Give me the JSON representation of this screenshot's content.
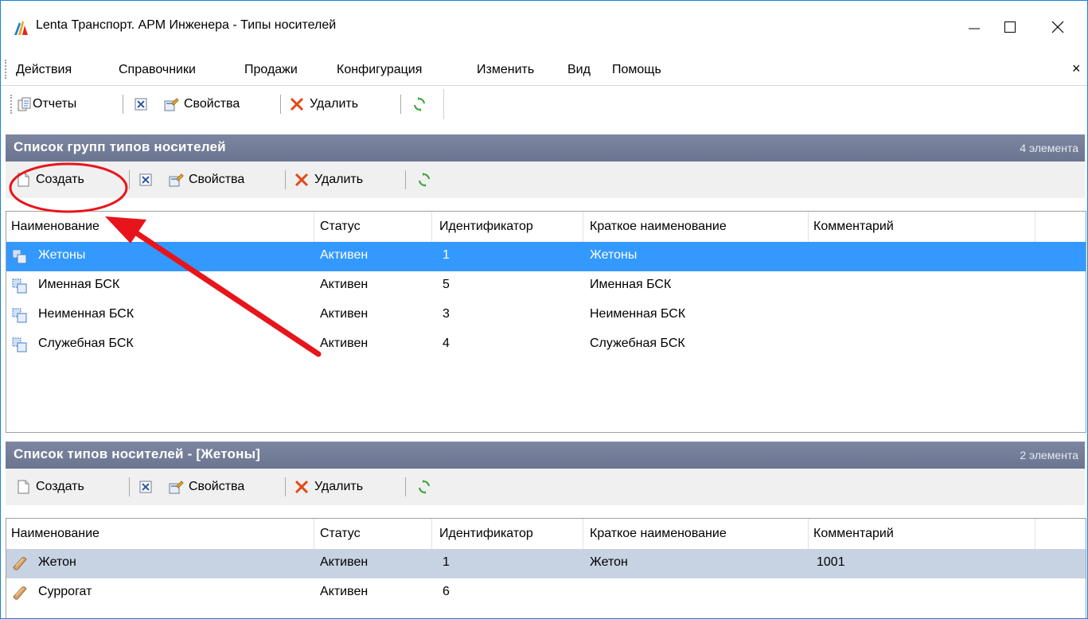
{
  "window": {
    "title": "Lenta Транспорт. АРМ Инженера - Типы носителей"
  },
  "menu": {
    "items": [
      "Действия",
      "Справочники",
      "Продажи",
      "Конфигурация",
      "Изменить",
      "Вид",
      "Помощь"
    ],
    "close": "×"
  },
  "main_toolbar": {
    "reports": "Отчеты",
    "properties": "Свойства",
    "delete": "Удалить"
  },
  "groups_section": {
    "title": "Список групп типов носителей",
    "count": "4 элемента",
    "toolbar": {
      "create": "Создать",
      "properties": "Свойства",
      "delete": "Удалить"
    },
    "columns": [
      "Наименование",
      "Статус",
      "Идентификатор",
      "Краткое наименование",
      "Комментарий"
    ],
    "rows": [
      {
        "name": "Жетоны",
        "status": "Активен",
        "id": "1",
        "short": "Жетоны",
        "comment": ""
      },
      {
        "name": "Именная БСК",
        "status": "Активен",
        "id": "5",
        "short": "Именная БСК",
        "comment": ""
      },
      {
        "name": "Неименная БСК",
        "status": "Активен",
        "id": "3",
        "short": "Неименная БСК",
        "comment": ""
      },
      {
        "name": "Служебная БСК",
        "status": "Активен",
        "id": "4",
        "short": "Служебная БСК",
        "comment": ""
      }
    ]
  },
  "types_section": {
    "title": "Список типов носителей - [Жетоны]",
    "count": "2 элемента",
    "toolbar": {
      "create": "Создать",
      "properties": "Свойства",
      "delete": "Удалить"
    },
    "columns": [
      "Наименование",
      "Статус",
      "Идентификатор",
      "Краткое наименование",
      "Комментарий"
    ],
    "rows": [
      {
        "name": "Жетон",
        "status": "Активен",
        "id": "1",
        "short": "Жетон",
        "comment": "1001"
      },
      {
        "name": "Суррогат",
        "status": "Активен",
        "id": "6",
        "short": "",
        "comment": ""
      }
    ]
  },
  "colors": {
    "accent": "#1883d7",
    "section_header": "#737c97",
    "selection": "#3399ff",
    "annotation": "#e8141b"
  }
}
